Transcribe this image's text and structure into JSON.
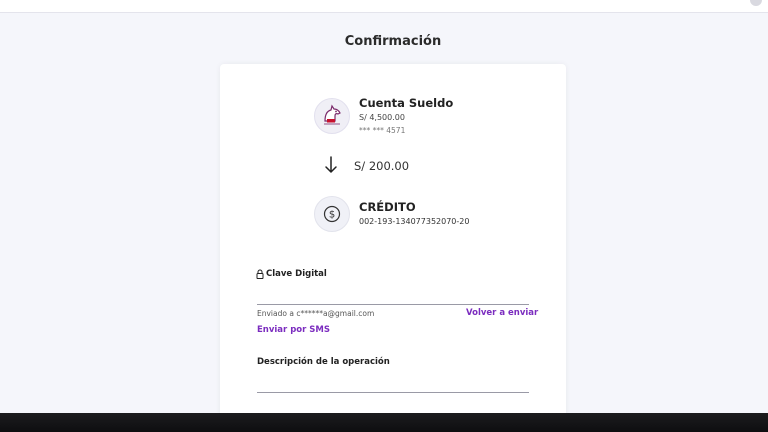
{
  "header": {
    "title": "Confirmación"
  },
  "source_account": {
    "name": "Cuenta Sueldo",
    "balance": "S/ 4,500.00",
    "number": "*** *** 4571",
    "icon": "llama-avatar-icon"
  },
  "transfer": {
    "amount": "S/ 200.00",
    "icon": "arrow-down-icon"
  },
  "destination": {
    "name": "CRÉDITO",
    "number": "002-193-134077352070-20",
    "icon": "dollar-circle-icon"
  },
  "clave": {
    "label": "Clave Digital",
    "value": "",
    "sent_to": "Enviado a c******a@gmail.com",
    "resend_label": "Volver a enviar",
    "sms_label": "Enviar por SMS"
  },
  "description": {
    "label": "Descripción de la operación",
    "value": ""
  },
  "colors": {
    "accent": "#7b2cbf",
    "background": "#f5f6fb",
    "card": "#ffffff"
  }
}
